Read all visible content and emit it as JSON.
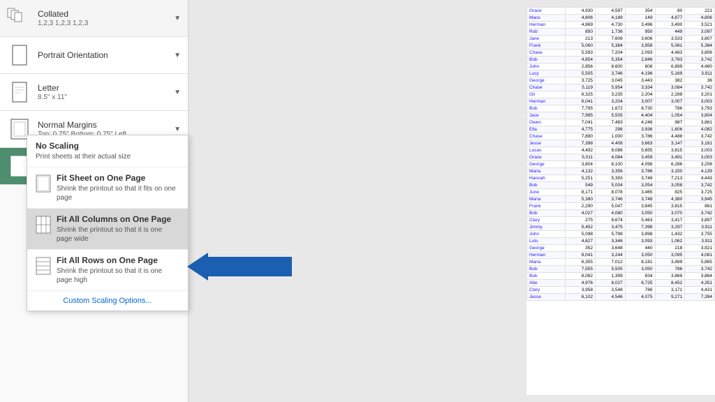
{
  "print_panel": {
    "options": [
      {
        "id": "collated",
        "main": "Collated",
        "sub": "1,2,3   1,2,3   1,2,3",
        "has_dropdown": true
      },
      {
        "id": "orientation",
        "main": "Portrait Orientation",
        "sub": "",
        "has_dropdown": true
      },
      {
        "id": "paper",
        "main": "Letter",
        "sub": "8.5\" x 11\"",
        "has_dropdown": true
      },
      {
        "id": "margins",
        "main": "Normal Margins",
        "sub": "Top: 0.75\" Bottom: 0.75\" Left...",
        "has_dropdown": true
      },
      {
        "id": "scaling",
        "main": "Fit Sheet on One Page",
        "sub": "Shrink the printout so that it...",
        "has_dropdown": true,
        "active": true
      }
    ]
  },
  "scaling_dropdown": {
    "items": [
      {
        "id": "no-scaling",
        "title": "No Scaling",
        "sub": "Print sheets at their actual size"
      },
      {
        "id": "fit-sheet",
        "title": "Fit Sheet on One Page",
        "sub": "Shrink the printout so that it fits on one page"
      },
      {
        "id": "fit-columns",
        "title": "Fit All Columns on One Page",
        "sub": "Shrink the printout so that it is one page wide",
        "highlighted": true
      },
      {
        "id": "fit-rows",
        "title": "Fit All Rows on One Page",
        "sub": "Shrink the printout so that it is one page high"
      }
    ],
    "custom_link": "Custom Scaling Options..."
  },
  "spreadsheet": {
    "rows": [
      [
        "Grace",
        "4,930",
        "4,597",
        "354",
        "80",
        "221"
      ],
      [
        "Mace",
        "4,806",
        "4,189",
        "149",
        "4,877",
        "4,806"
      ],
      [
        "Herman",
        "4,869",
        "4,730",
        "3,496",
        "3,490",
        "3,521"
      ],
      [
        "Rob",
        "850",
        "1,736",
        "950",
        "449",
        "3,097"
      ],
      [
        "Jane",
        "213",
        "7,606",
        "3,606",
        "3,533",
        "3,807"
      ],
      [
        "Frank",
        "5,060",
        "5,384",
        "3,958",
        "5,061",
        "5,384"
      ],
      [
        "Chase",
        "5,593",
        "7,204",
        "2,093",
        "4,483",
        "3,806"
      ],
      [
        "Bob",
        "4,854",
        "5,354",
        "2,846",
        "3,783",
        "3,742"
      ],
      [
        "John",
        "2,856",
        "8,600",
        "808",
        "6,899",
        "4,480"
      ],
      [
        "Lucy",
        "5,505",
        "3,746",
        "4,196",
        "5,169",
        "3,911"
      ],
      [
        "George",
        "3,725",
        "3,045",
        "3,443",
        "382",
        "36"
      ],
      [
        "Chase",
        "5,119",
        "5,954",
        "3,334",
        "3,084",
        "3,742"
      ],
      [
        "Gil",
        "6,325",
        "3,235",
        "2,204",
        "2,288",
        "3,201"
      ],
      [
        "Herman",
        "6,041",
        "3,204",
        "3,007",
        "3,007",
        "3,003"
      ],
      [
        "Bob",
        "7,795",
        "1,672",
        "8,730",
        "786",
        "3,793"
      ],
      [
        "Jace",
        "7,995",
        "5,505",
        "4,404",
        "1,054",
        "3,804"
      ],
      [
        "Owen",
        "7,041",
        "7,483",
        "4,246",
        "987",
        "3,861"
      ],
      [
        "Ella",
        "4,775",
        "298",
        "3,936",
        "1,606",
        "4,082"
      ],
      [
        "Chase",
        "7,890",
        "1,000",
        "3,786",
        "4,488",
        "3,742"
      ],
      [
        "Jesse",
        "7,398",
        "4,408",
        "3,663",
        "3,147",
        "3,181"
      ],
      [
        "Lucas",
        "4,492",
        "8,086",
        "5,655",
        "3,815",
        "3,003"
      ],
      [
        "Grace",
        "5,011",
        "4,084",
        "3,459",
        "3,491",
        "3,003"
      ],
      [
        "George",
        "3,804",
        "8,100",
        "4,098",
        "6,286",
        "3,208"
      ],
      [
        "Maria",
        "4,132",
        "3,356",
        "3,786",
        "3,150",
        "4,139"
      ],
      [
        "Hannah",
        "5,251",
        "5,393",
        "3,748",
        "7,213",
        "4,443"
      ],
      [
        "Bob",
        "549",
        "5,004",
        "3,054",
        "3,058",
        "3,742"
      ],
      [
        "June",
        "8,171",
        "8,078",
        "3,465",
        "825",
        "3,725"
      ],
      [
        "Maria",
        "5,380",
        "3,746",
        "3,748",
        "4,380",
        "3,945"
      ],
      [
        "Frank",
        "2,290",
        "5,047",
        "3,845",
        "3,815",
        "861"
      ],
      [
        "Bob",
        "4,027",
        "4,080",
        "3,050",
        "3,070",
        "3,742"
      ],
      [
        "Clary",
        "275",
        "8,674",
        "5,463",
        "3,417",
        "3,897"
      ],
      [
        "Jimmy",
        "5,452",
        "3,475",
        "7,398",
        "3,297",
        "3,911"
      ],
      [
        "John",
        "5,098",
        "5,798",
        "3,898",
        "1,432",
        "3,755"
      ],
      [
        "Lulu",
        "4,627",
        "3,346",
        "3,093",
        "1,062",
        "3,911"
      ],
      [
        "George",
        "352",
        "3,648",
        "440",
        "218",
        "3,921"
      ],
      [
        "Herman",
        "8,041",
        "3,244",
        "3,050",
        "3,095",
        "4,081"
      ],
      [
        "Maria",
        "6,355",
        "7,012",
        "8,181",
        "3,489",
        "5,865"
      ],
      [
        "Bob",
        "7,555",
        "5,505",
        "3,050",
        "786",
        "3,742"
      ],
      [
        "Bob",
        "8,082",
        "1,399",
        "834",
        "3,869",
        "3,864"
      ],
      [
        "Abe",
        "4,976",
        "8,027",
        "6,725",
        "8,452",
        "4,351"
      ],
      [
        "Clary",
        "3,958",
        "3,548",
        "786",
        "3,171",
        "4,431"
      ],
      [
        "Jesse",
        "6,102",
        "4,546",
        "4,075",
        "9,271",
        "7,394"
      ]
    ]
  },
  "colors": {
    "active_green": "#4e8d6e",
    "blue_arrow": "#1a5fb0",
    "highlighted_row": "#e0e0e0"
  }
}
